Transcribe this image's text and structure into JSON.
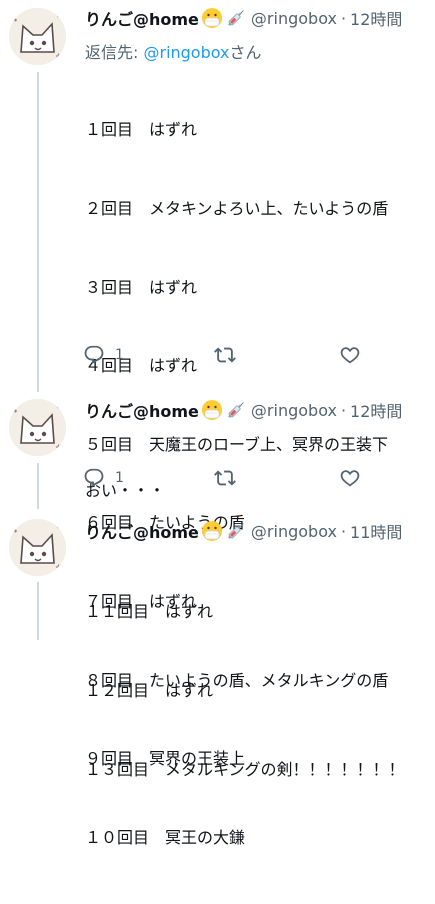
{
  "tweets": [
    {
      "name": "りんご@home",
      "handle": "@ringobox",
      "dot": "·",
      "time": "12時間",
      "reply_prefix": "返信先: ",
      "reply_mention": "@ringobox",
      "reply_suffix": "さん",
      "lines": [
        "１回目　はずれ",
        "２回目　メタキンよろい上、たいようの盾",
        "３回目　はずれ",
        "４回目　はずれ",
        "５回目　天魔王のローブ上、冥界の王装下",
        "６回目　たいようの盾",
        "７回目　はずれ",
        "８回目　たいようの盾、メタルキングの盾",
        "９回目　冥界の王装上",
        "１０回目　冥王の大鎌"
      ],
      "reply_count": "1"
    },
    {
      "name": "りんご@home",
      "handle": "@ringobox",
      "dot": "·",
      "time": "12時間",
      "lines": [
        "おい・・・"
      ],
      "reply_count": "1"
    },
    {
      "name": "りんご@home",
      "handle": "@ringobox",
      "dot": "·",
      "time": "11時間",
      "lines": [
        "１１回目　はずれ",
        "１２回目　はずれ",
        "１３回目　メタルキングの剣！！！！！！！"
      ]
    }
  ],
  "icons": {
    "emoji_mask": "face-with-medical-mask-icon",
    "emoji_syringe": "syringe-icon",
    "reply": "reply-icon",
    "retweet": "retweet-icon",
    "like": "like-icon"
  },
  "colors": {
    "text": "#0f1419",
    "secondary": "#536471",
    "link": "#1d9bf0",
    "thread_line": "#cfd9de"
  }
}
